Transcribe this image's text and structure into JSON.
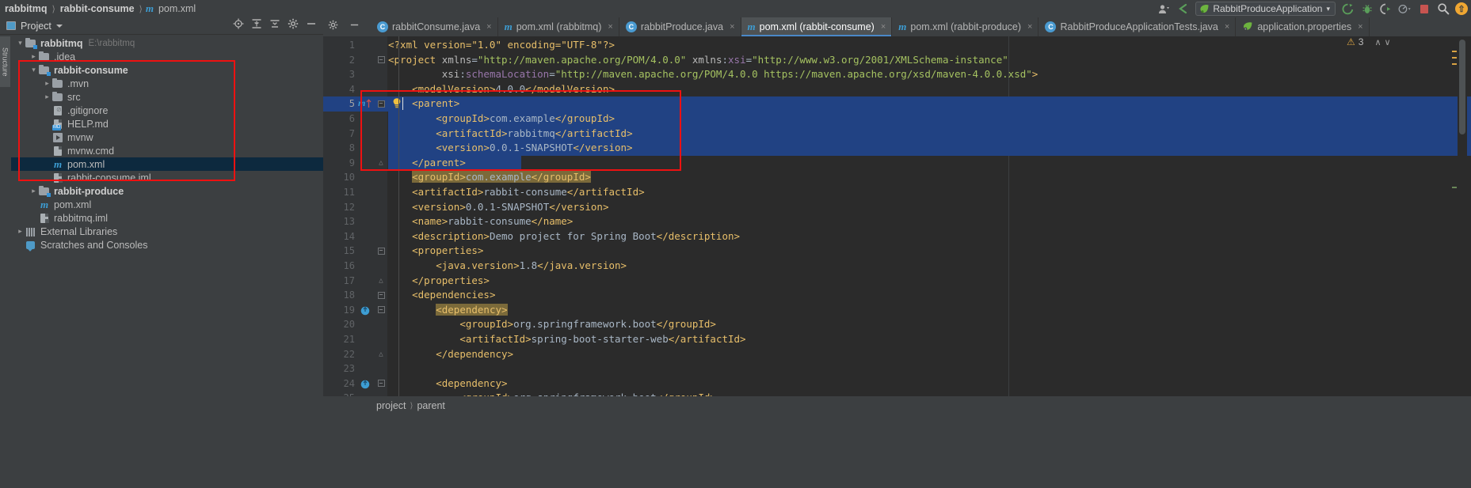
{
  "window": {
    "breadcrumbs": [
      {
        "label": "rabbitmq",
        "bold": true
      },
      {
        "label": "rabbit-consume",
        "bold": true
      },
      {
        "label": "pom.xml",
        "bold": false
      }
    ],
    "maven_glyph": "m"
  },
  "toolbar_right": {
    "user_icon": "user-icon",
    "back_arrow": "back-arrow-icon",
    "run_config": "RabbitProduceApplication",
    "run_label": "run-icon",
    "debug_label": "debug-icon",
    "run_coverage_label": "run-with-coverage-icon",
    "profile_label": "profile-icon",
    "stop_label": "stop-icon",
    "search_label": "search-everywhere-icon",
    "update_label": "update-icon",
    "dropdown_caret": "▾"
  },
  "project_panel": {
    "title": "Project",
    "caret": "▾",
    "vertical_tab": "Structure",
    "actions": [
      "locate-icon",
      "collapse-all-icon",
      "expand-settings-icon",
      "gear-icon",
      "hide-icon"
    ],
    "tree": [
      {
        "indent": 0,
        "arrow": "open",
        "icon": "module-folder",
        "label": "rabbitmq",
        "bold": true,
        "sub": "E:\\rabbitmq",
        "selected": false
      },
      {
        "indent": 1,
        "arrow": "closed",
        "icon": "folder",
        "label": ".idea",
        "bold": false,
        "sub": "",
        "selected": false
      },
      {
        "indent": 1,
        "arrow": "open",
        "icon": "module-folder",
        "label": "rabbit-consume",
        "bold": true,
        "sub": "",
        "selected": false
      },
      {
        "indent": 2,
        "arrow": "closed",
        "icon": "folder",
        "label": ".mvn",
        "bold": false,
        "sub": "",
        "selected": false
      },
      {
        "indent": 2,
        "arrow": "closed",
        "icon": "folder",
        "label": "src",
        "bold": false,
        "sub": "",
        "selected": false
      },
      {
        "indent": 2,
        "arrow": "none",
        "icon": "gitignore",
        "label": ".gitignore",
        "bold": false,
        "sub": "",
        "selected": false
      },
      {
        "indent": 2,
        "arrow": "none",
        "icon": "markdown",
        "label": "HELP.md",
        "bold": false,
        "sub": "",
        "selected": false
      },
      {
        "indent": 2,
        "arrow": "none",
        "icon": "shellscript",
        "label": "mvnw",
        "bold": false,
        "sub": "",
        "selected": false
      },
      {
        "indent": 2,
        "arrow": "none",
        "icon": "cmdfile",
        "label": "mvnw.cmd",
        "bold": false,
        "sub": "",
        "selected": false
      },
      {
        "indent": 2,
        "arrow": "none",
        "icon": "maven",
        "label": "pom.xml",
        "bold": false,
        "sub": "",
        "selected": true
      },
      {
        "indent": 2,
        "arrow": "none",
        "icon": "iml",
        "label": "rabbit-consume.iml",
        "bold": false,
        "sub": "",
        "selected": false
      },
      {
        "indent": 1,
        "arrow": "closed",
        "icon": "module-folder",
        "label": "rabbit-produce",
        "bold": true,
        "sub": "",
        "selected": false
      },
      {
        "indent": 1,
        "arrow": "none",
        "icon": "maven",
        "label": "pom.xml",
        "bold": false,
        "sub": "",
        "selected": false
      },
      {
        "indent": 1,
        "arrow": "none",
        "icon": "iml",
        "label": "rabbitmq.iml",
        "bold": false,
        "sub": "",
        "selected": false
      },
      {
        "indent": 0,
        "arrow": "closed",
        "icon": "libraries",
        "label": "External Libraries",
        "bold": false,
        "sub": "",
        "selected": false
      },
      {
        "indent": 0,
        "arrow": "none",
        "icon": "scratches",
        "label": "Scratches and Consoles",
        "bold": false,
        "sub": "",
        "selected": false
      }
    ]
  },
  "editor_tabs": [
    {
      "label": "rabbitConsume.java",
      "icon": "java-class-icon",
      "active": false,
      "close": "×"
    },
    {
      "label": "pom.xml (rabbitmq)",
      "icon": "maven-icon",
      "active": false,
      "close": "×"
    },
    {
      "label": "rabbitProduce.java",
      "icon": "java-class-icon",
      "active": false,
      "close": "×"
    },
    {
      "label": "pom.xml (rabbit-consume)",
      "icon": "maven-icon",
      "active": true,
      "close": "×"
    },
    {
      "label": "pom.xml (rabbit-produce)",
      "icon": "maven-icon",
      "active": false,
      "close": "×"
    },
    {
      "label": "RabbitProduceApplicationTests.java",
      "icon": "java-class-icon",
      "active": false,
      "close": "×"
    },
    {
      "label": "application.properties",
      "icon": "spring-properties-icon",
      "active": false,
      "close": "×"
    }
  ],
  "inspection": {
    "warning_icon": "⚠",
    "warning_count": "3",
    "up_chevron": "∧",
    "down_chevron": "∨"
  },
  "code": {
    "filename": "pom.xml",
    "lines": [
      {
        "n": 1,
        "indent": 0,
        "text": "<?xml version=\"1.0\" encoding=\"UTF-8\"?>"
      },
      {
        "n": 2,
        "indent": 0,
        "text": "<project xmlns=\"http://maven.apache.org/POM/4.0.0\" xmlns:xsi=\"http://www.w3.org/2001/XMLSchema-instance\""
      },
      {
        "n": 3,
        "indent": 0,
        "text": "         xsi:schemaLocation=\"http://maven.apache.org/POM/4.0.0 https://maven.apache.org/xsd/maven-4.0.0.xsd\">"
      },
      {
        "n": 4,
        "indent": 0,
        "text": "    <modelVersion>4.0.0</modelVersion>"
      },
      {
        "n": 5,
        "indent": 0,
        "text": "    <parent>"
      },
      {
        "n": 6,
        "indent": 0,
        "text": "        <groupId>com.example</groupId>"
      },
      {
        "n": 7,
        "indent": 0,
        "text": "        <artifactId>rabbitmq</artifactId>"
      },
      {
        "n": 8,
        "indent": 0,
        "text": "        <version>0.0.1-SNAPSHOT</version>"
      },
      {
        "n": 9,
        "indent": 0,
        "text": "    </parent>"
      },
      {
        "n": 10,
        "indent": 0,
        "text": "    <groupId>com.example</groupId>"
      },
      {
        "n": 11,
        "indent": 0,
        "text": "    <artifactId>rabbit-consume</artifactId>"
      },
      {
        "n": 12,
        "indent": 0,
        "text": "    <version>0.0.1-SNAPSHOT</version>"
      },
      {
        "n": 13,
        "indent": 0,
        "text": "    <name>rabbit-consume</name>"
      },
      {
        "n": 14,
        "indent": 0,
        "text": "    <description>Demo project for Spring Boot</description>"
      },
      {
        "n": 15,
        "indent": 0,
        "text": "    <properties>"
      },
      {
        "n": 16,
        "indent": 0,
        "text": "        <java.version>1.8</java.version>"
      },
      {
        "n": 17,
        "indent": 0,
        "text": "    </properties>"
      },
      {
        "n": 18,
        "indent": 0,
        "text": "    <dependencies>"
      },
      {
        "n": 19,
        "indent": 0,
        "text": "        <dependency>"
      },
      {
        "n": 20,
        "indent": 0,
        "text": "            <groupId>org.springframework.boot</groupId>"
      },
      {
        "n": 21,
        "indent": 0,
        "text": "            <artifactId>spring-boot-starter-web</artifactId>"
      },
      {
        "n": 22,
        "indent": 0,
        "text": "        </dependency>"
      },
      {
        "n": 23,
        "indent": 0,
        "text": ""
      },
      {
        "n": 24,
        "indent": 0,
        "text": "        <dependency>"
      },
      {
        "n": 25,
        "indent": 0,
        "text": "            <groupId>org.springframework.boot</groupId>"
      }
    ],
    "selection_lines": [
      5,
      6,
      7,
      8,
      9
    ],
    "current_line": 5,
    "find_highlight_lines": [
      10,
      19
    ],
    "bulb_line": 5,
    "maven_update_line": 5,
    "spring_bean_lines": [
      19,
      24
    ]
  },
  "status_breadcrumb": [
    {
      "label": "project"
    },
    {
      "label": "parent"
    }
  ],
  "colors": {
    "accent_blue": "#4a88c7",
    "selection_blue": "#214283",
    "annotation_red": "#ee1111",
    "editor_bg": "#2b2b2b",
    "chrome_bg": "#3c3f41",
    "tag": "#e8bf6a",
    "value": "#a5c261",
    "text": "#a9b7c6",
    "namespace": "#9876aa"
  }
}
